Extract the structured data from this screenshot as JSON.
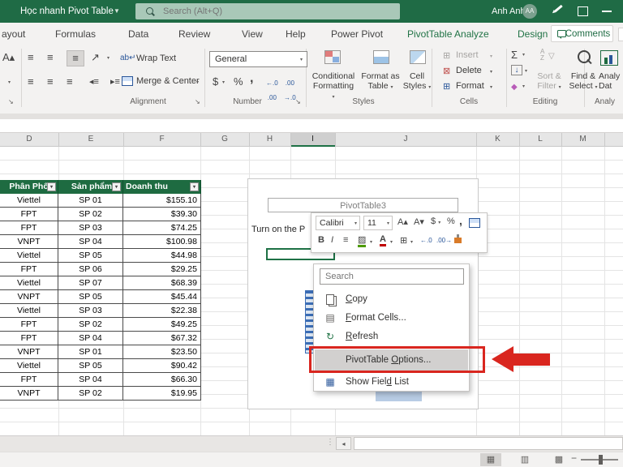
{
  "title_bar": {
    "doc_title": "Học nhanh Pivot Table",
    "search_placeholder": "Search (Alt+Q)",
    "user_name": "Anh Anh",
    "user_initials": "AA"
  },
  "tabs": {
    "items": [
      "ayout",
      "Formulas",
      "Data",
      "Review",
      "View",
      "Help",
      "Power Pivot",
      "PivotTable Analyze",
      "Design"
    ],
    "comments_label": "Comments"
  },
  "ribbon": {
    "alignment": {
      "wrap_text": "Wrap Text",
      "merge_center": "Merge & Center",
      "label": "Alignment"
    },
    "number": {
      "format_value": "General",
      "label": "Number"
    },
    "styles": {
      "conditional_1": "Conditional",
      "conditional_2": "Formatting",
      "format_table_1": "Format as",
      "format_table_2": "Table",
      "cell_styles_1": "Cell",
      "cell_styles_2": "Styles",
      "label": "Styles"
    },
    "cells": {
      "insert": "Insert",
      "delete": "Delete",
      "format": "Format",
      "label": "Cells"
    },
    "editing": {
      "sort_1": "Sort &",
      "sort_2": "Filter",
      "find_1": "Find &",
      "find_2": "Select",
      "label": "Editing"
    },
    "analyze": {
      "line1": "Analy",
      "line2": "Dat",
      "label": "Analy"
    }
  },
  "sheet": {
    "columns": [
      "D",
      "E",
      "F",
      "G",
      "H",
      "I",
      "J",
      "K",
      "L",
      "M"
    ],
    "selected_column": "I",
    "table": {
      "headers": [
        "Phân Phối",
        "Sản phẩm",
        "Doanh thu"
      ],
      "rows": [
        [
          "Viettel",
          "SP 01",
          "$155.10"
        ],
        [
          "FPT",
          "SP 02",
          "$39.30"
        ],
        [
          "FPT",
          "SP 03",
          "$74.25"
        ],
        [
          "VNPT",
          "SP 04",
          "$100.98"
        ],
        [
          "Viettel",
          "SP 05",
          "$44.98"
        ],
        [
          "FPT",
          "SP 06",
          "$29.25"
        ],
        [
          "Viettel",
          "SP 07",
          "$68.39"
        ],
        [
          "VNPT",
          "SP 05",
          "$45.44"
        ],
        [
          "Viettel",
          "SP 03",
          "$22.38"
        ],
        [
          "FPT",
          "SP 02",
          "$49.25"
        ],
        [
          "FPT",
          "SP 04",
          "$67.32"
        ],
        [
          "VNPT",
          "SP 01",
          "$23.50"
        ],
        [
          "Viettel",
          "SP 05",
          "$90.42"
        ],
        [
          "FPT",
          "SP 04",
          "$66.30"
        ],
        [
          "VNPT",
          "SP 02",
          "$19.95"
        ]
      ]
    },
    "pivot": {
      "name": "PivotTable3",
      "hint_fragment": "Turn on the P"
    },
    "mini_toolbar": {
      "font": "Calibri",
      "size": "11"
    },
    "context_menu": {
      "search_placeholder": "Search",
      "items": [
        {
          "pre": "",
          "key": "C",
          "post": "opy"
        },
        {
          "pre": "",
          "key": "F",
          "post": "ormat Cells..."
        },
        {
          "pre": "",
          "key": "R",
          "post": "efresh"
        },
        {
          "pre": "PivotTable ",
          "key": "O",
          "post": "ptions..."
        },
        {
          "pre": "Show Fiel",
          "key": "d",
          "post": " List"
        }
      ],
      "highlighted_item": "PivotTable Options..."
    }
  },
  "colors": {
    "accent_green": "#1e6b41",
    "annotation_red": "#d9261f",
    "title_green": "#1f6b45"
  }
}
